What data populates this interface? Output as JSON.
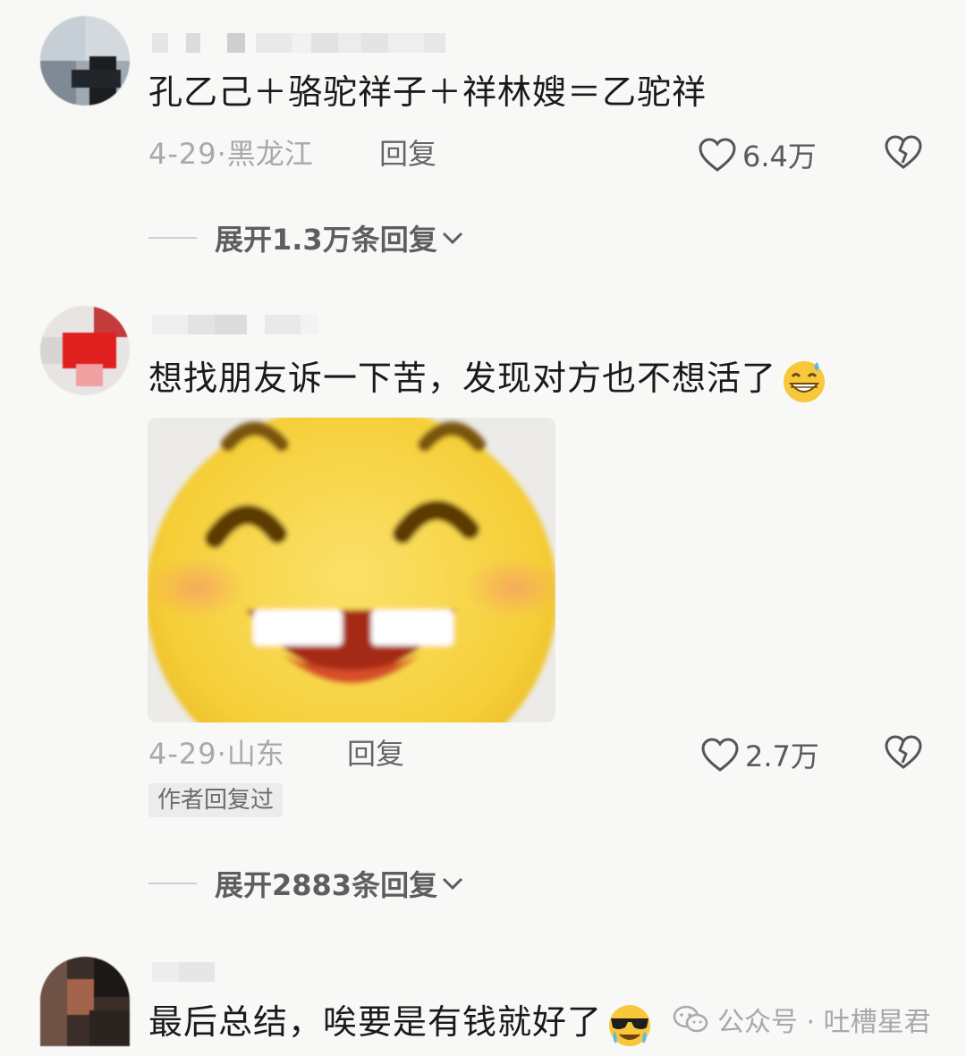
{
  "comments": [
    {
      "text": "孔乙己＋骆驼祥子＋祥林嫂＝乙驼祥",
      "date": "4-29·",
      "location": "黑龙江",
      "reply_label": "回复",
      "likes": "6.4万",
      "expand_label": "展开1.3万条回复"
    },
    {
      "text": "想找朋友诉一下苦，发现对方也不想活了",
      "date": "4-29·",
      "location": "山东",
      "reply_label": "回复",
      "likes": "2.7万",
      "author_tag": "作者回复过",
      "expand_label": "展开2883条回复"
    },
    {
      "text": "最后总结，唉要是有钱就好了"
    }
  ],
  "watermark": {
    "label": "公众号 · 吐槽星君"
  },
  "icons": {
    "like": "heart-outline-icon",
    "dislike": "broken-heart-icon",
    "expand": "chevron-down-icon",
    "emoji_1": "grinning-sweat-emoji-icon",
    "emoji_2": "sunglasses-crying-emoji-icon",
    "watermark": "wechat-icon"
  },
  "colors": {
    "text": "#1a1a1a",
    "meta": "#a9a9a9",
    "background": "#f8f8f6",
    "sticker_yellow": "#f7d64a"
  }
}
